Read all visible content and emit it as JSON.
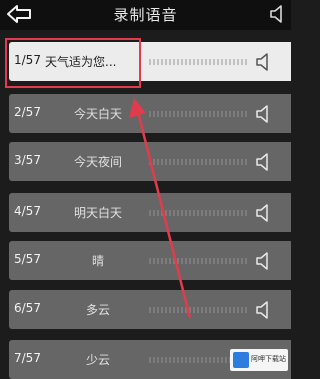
{
  "header": {
    "title": "录制语音"
  },
  "colors": {
    "accent": "#e13b4d",
    "row_bg": "#666666",
    "active_row_bg": "#ececec"
  },
  "rows": [
    {
      "index": "1/57",
      "label": "天气适为您..."
    },
    {
      "index": "2/57",
      "label": "今天白天"
    },
    {
      "index": "3/57",
      "label": "今天夜间"
    },
    {
      "index": "4/57",
      "label": "明天白天"
    },
    {
      "index": "5/57",
      "label": "晴"
    },
    {
      "index": "6/57",
      "label": "多云"
    },
    {
      "index": "7/57",
      "label": "少云"
    }
  ],
  "watermark": {
    "text": "阿呷下载站"
  }
}
